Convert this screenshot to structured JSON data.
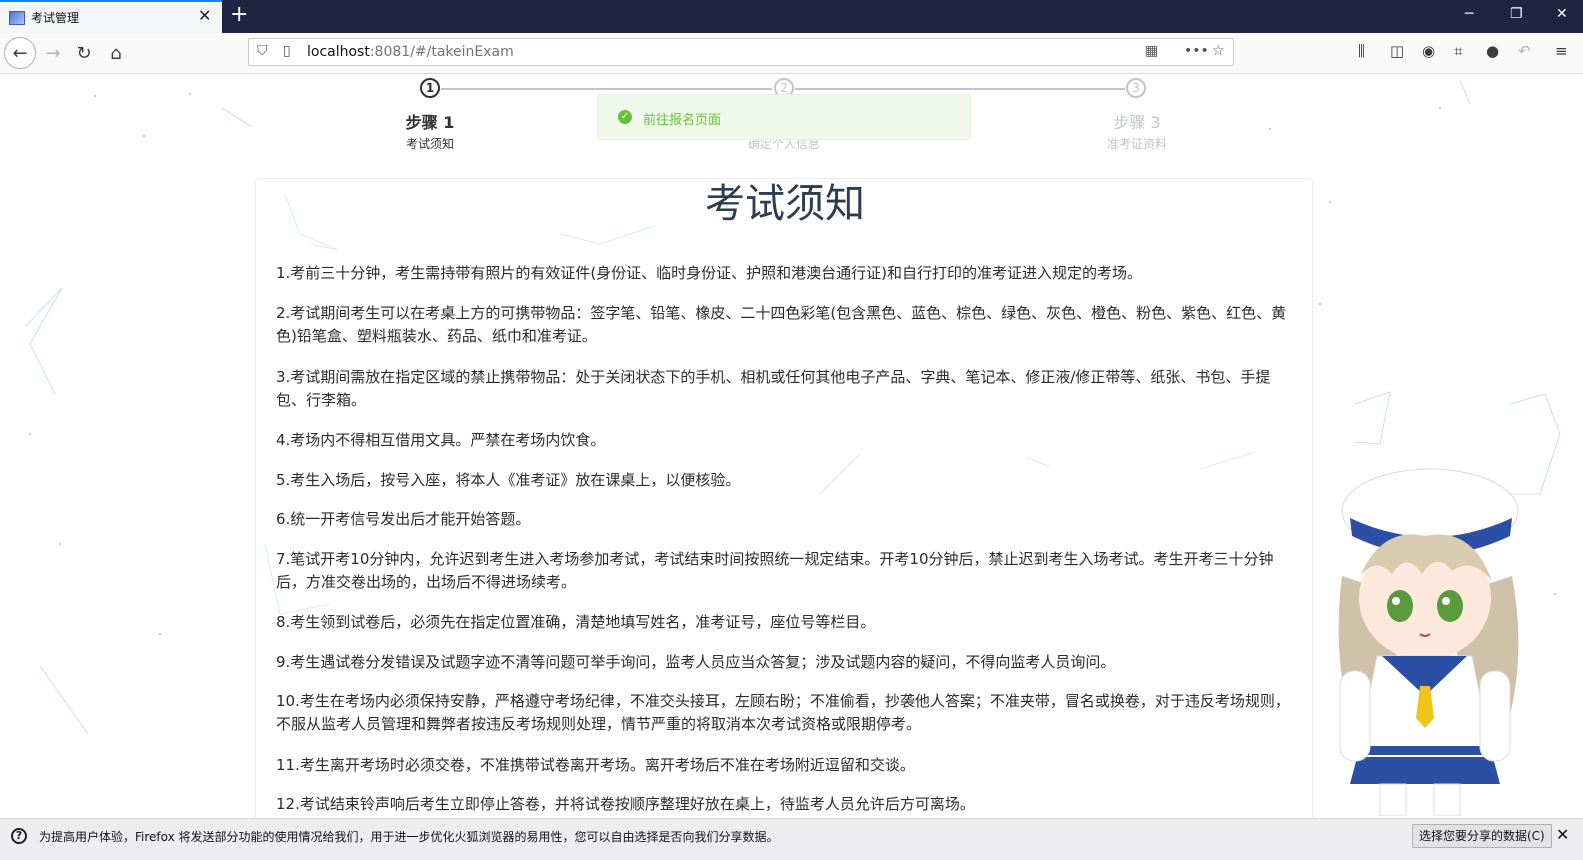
{
  "browser": {
    "tab_title": "考试管理",
    "url_host": "localhost",
    "url_rest": ":8081/#/takeinExam"
  },
  "steps": [
    {
      "number": "1",
      "title": "步骤 1",
      "desc": "考试须知",
      "state": "active"
    },
    {
      "number": "2",
      "title": "",
      "desc": "确定个人信息",
      "state": "idle"
    },
    {
      "number": "3",
      "title": "步骤 3",
      "desc": "准考证资料",
      "state": "idle"
    }
  ],
  "toast": {
    "message": "前往报名页面",
    "color": "#67c23a"
  },
  "notice": {
    "title": "考试须知",
    "rules": [
      "1.考前三十分钟，考生需持带有照片的有效证件(身份证、临时身份证、护照和港澳台通行证)和自行打印的准考证进入规定的考场。",
      "2.考试期间考生可以在考桌上方的可携带物品：签字笔、铅笔、橡皮、二十四色彩笔(包含黑色、蓝色、棕色、绿色、灰色、橙色、粉色、紫色、红色、黄色)铅笔盒、塑料瓶装水、药品、纸巾和准考证。",
      "3.考试期间需放在指定区域的禁止携带物品：处于关闭状态下的手机、相机或任何其他电子产品、字典、笔记本、修正液/修正带等、纸张、书包、手提包、行李箱。",
      "4.考场内不得相互借用文具。严禁在考场内饮食。",
      "5.考生入场后，按号入座，将本人《准考证》放在课桌上，以便核验。",
      "6.统一开考信号发出后才能开始答题。",
      "7.笔试开考10分钟内，允许迟到考生进入考场参加考试，考试结束时间按照统一规定结束。开考10分钟后，禁止迟到考生入场考试。考生开考三十分钟后，方准交卷出场的，出场后不得进场续考。",
      "8.考生领到试卷后，必须先在指定位置准确，清楚地填写姓名，准考证号，座位号等栏目。",
      "9.考生遇试卷分发错误及试题字迹不清等问题可举手询问，监考人员应当众答复；涉及试题内容的疑问，不得向监考人员询问。",
      "10.考生在考场内必须保持安静，严格遵守考场纪律，不准交头接耳，左顾右盼；不准偷看，抄袭他人答案；不准夹带，冒名或换卷，对于违反考场规则，不服从监考人员管理和舞弊者按违反考场规则处理，情节严重的将取消本次考试资格或限期停考。",
      "11.考生离开考场时必须交卷，不准携带试卷离开考场。离开考场后不准在考场附近逗留和交谈。",
      "12.考试结束铃声响后考生立即停止答卷，并将试卷按顺序整理好放在桌上，待监考人员允许后方可离场。"
    ]
  },
  "notification": {
    "text": "为提高用户体验，Firefox 将发送部分功能的使用情况给我们，用于进一步优化火狐浏览器的易用性，您可以自由选择是否向我们分享数据。",
    "button": "选择您要分享的数据(C)"
  }
}
